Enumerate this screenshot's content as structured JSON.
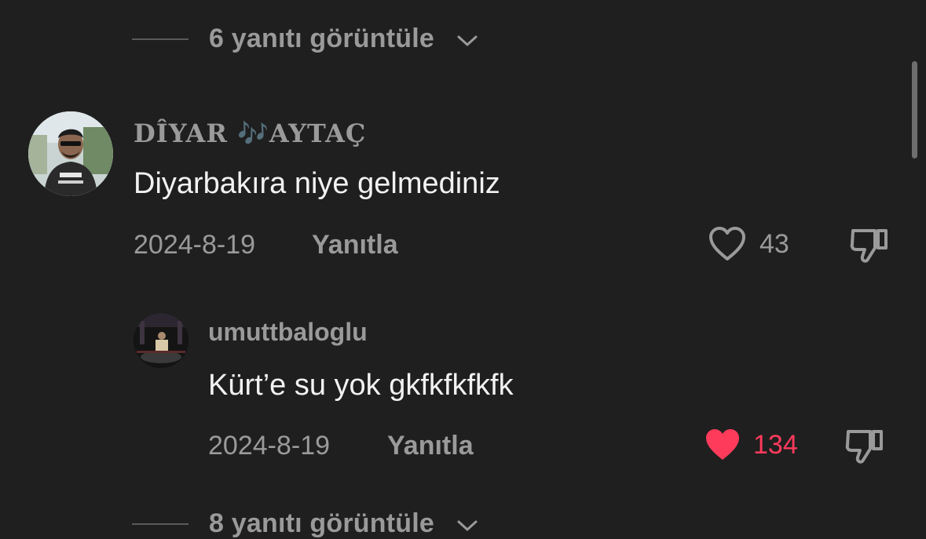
{
  "top_view_replies": {
    "label": "6 yanıtı görüntüle"
  },
  "comment": {
    "username": "DÎYAR 🎶AYTAÇ",
    "text": "Diyarbakıra niye gelmediniz",
    "date": "2024-8-19",
    "reply_label": "Yanıtla",
    "like_count": "43",
    "liked": false,
    "like_icon": "heart-outline-icon",
    "dislike_icon": "thumbs-down-icon"
  },
  "reply": {
    "username": "umuttbaloglu",
    "text": "Kürt’e su yok gkfkfkfkfk",
    "date": "2024-8-19",
    "reply_label": "Yanıtla",
    "like_count": "134",
    "liked": true,
    "like_icon": "heart-filled-icon",
    "dislike_icon": "thumbs-down-icon"
  },
  "bottom_view_replies": {
    "label": "8 yanıtı görüntüle"
  },
  "colors": {
    "background": "#1f1f1f",
    "muted_text": "#9a9a9a",
    "liked_red": "#ff3b5c"
  }
}
